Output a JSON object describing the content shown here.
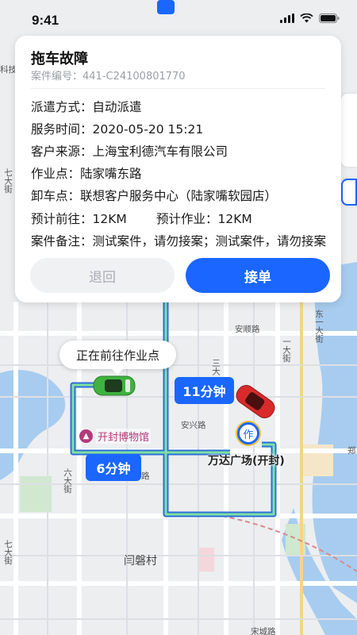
{
  "status_bar": {
    "time": "9:41"
  },
  "card": {
    "title": "拖车故障",
    "case_number_label": "案件编号：",
    "case_number": "441-C24100801770",
    "rows": [
      {
        "label": "派遣方式：",
        "value": "自动派遣"
      },
      {
        "label": "服务时间：",
        "value": "2020-05-20 15:21"
      },
      {
        "label": "客户来源：",
        "value": "上海宝利德汽车有限公司"
      },
      {
        "label": "作业点：",
        "value": "陆家嘴东路"
      },
      {
        "label": "卸车点：",
        "value": "联想客户服务中心（陆家嘴软园店）"
      }
    ],
    "estimates": {
      "travel_label": "预计前往：",
      "travel_value": "12KM",
      "work_label": "预计作业：",
      "work_value": "12KM"
    },
    "remark": {
      "label": "案件备注：",
      "value": "测试案件，请勿接案；测试案件，请勿接案"
    },
    "buttons": {
      "back": "退回",
      "accept": "接单"
    }
  },
  "map": {
    "callout": "正在前往作业点",
    "eta_top": "11分钟",
    "eta_bottom": "6分钟",
    "museum": "开封博物馆",
    "destination_icon": "作",
    "destination": "万达广场(开封)",
    "labels": {
      "keji": "科技",
      "qida": "七大街",
      "anshun": "安顺路",
      "yida": "一大街",
      "dongyi": "东一大街",
      "sanda": "三大",
      "anxing": "安兴路",
      "liuda": "六大街",
      "qida2": "七大街",
      "yanpan": "闫磐村",
      "songcheng": "宋城路",
      "zheng": "郑",
      "lu": "路"
    }
  }
}
